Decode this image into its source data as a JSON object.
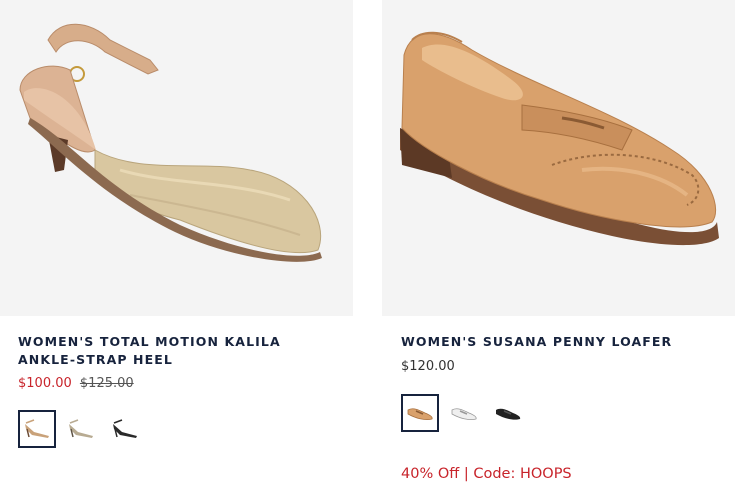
{
  "products": [
    {
      "title": "WOMEN'S TOTAL MOTION KALILA ANKLE-STRAP HEEL",
      "sale_price": "$100.00",
      "original_price": "$125.00",
      "swatches": [
        {
          "color": "#c9a27a",
          "icon": "nude-heel-icon",
          "selected": true
        },
        {
          "color": "#b8ab92",
          "icon": "taupe-heel-icon",
          "selected": false
        },
        {
          "color": "#2a2a2a",
          "icon": "black-heel-icon",
          "selected": false
        }
      ]
    },
    {
      "title": "WOMEN'S SUSANA PENNY LOAFER",
      "price": "$120.00",
      "promo": "40% Off | Code: HOOPS",
      "swatches": [
        {
          "color": "#d9a16c",
          "icon": "tan-loafer-icon",
          "selected": true
        },
        {
          "color": "#efefef",
          "icon": "white-loafer-icon",
          "selected": false
        },
        {
          "color": "#222222",
          "icon": "black-loafer-icon",
          "selected": false
        }
      ]
    }
  ],
  "colors": {
    "title": "#17233d",
    "sale": "#c8242b",
    "image_bg": "#f4f4f4"
  }
}
